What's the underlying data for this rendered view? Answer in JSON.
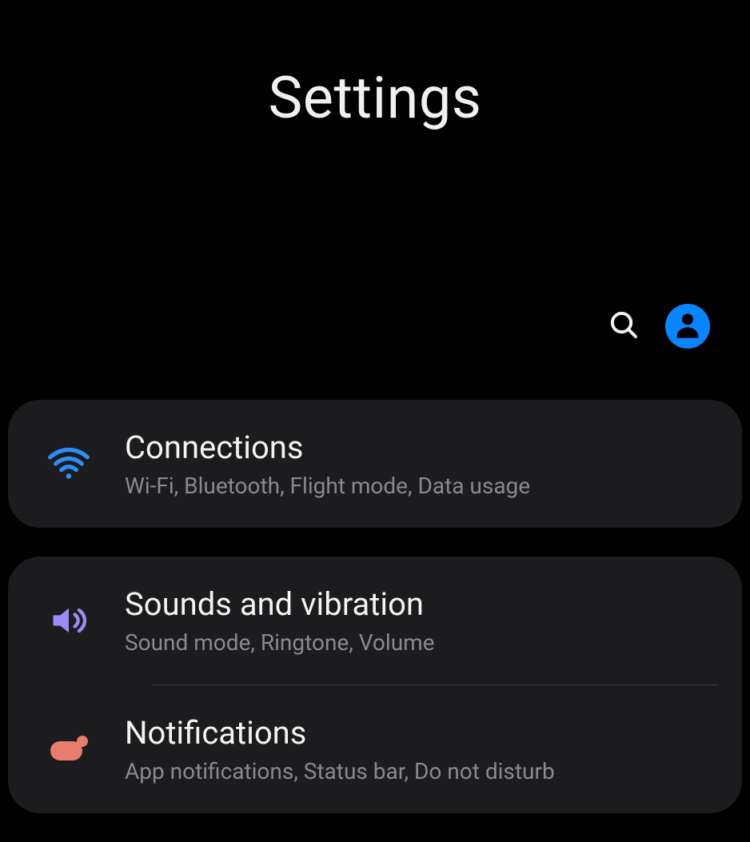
{
  "header": {
    "title": "Settings"
  },
  "settings": {
    "connections": {
      "title": "Connections",
      "subtitle": "Wi-Fi, Bluetooth, Flight mode, Data usage"
    },
    "sounds": {
      "title": "Sounds and vibration",
      "subtitle": "Sound mode, Ringtone, Volume"
    },
    "notifications": {
      "title": "Notifications",
      "subtitle": "App notifications, Status bar, Do not disturb"
    }
  },
  "colors": {
    "wifi": "#2e8ef7",
    "sound": "#9b8cf6",
    "notif": "#e87c6f",
    "avatar": "#0a84ff"
  }
}
